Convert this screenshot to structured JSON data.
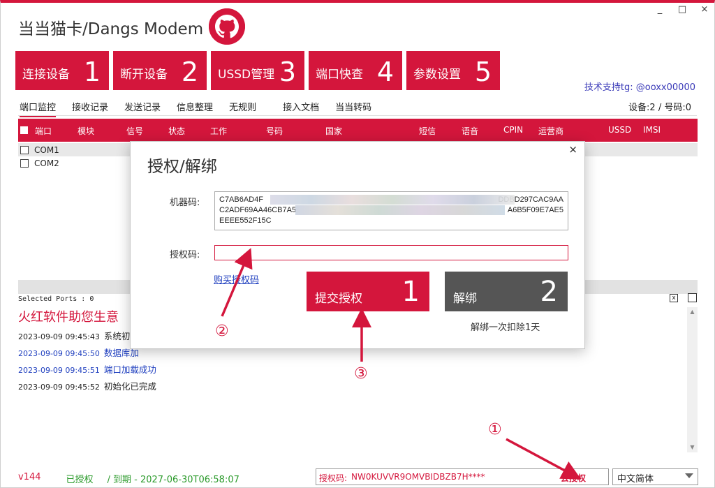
{
  "app": {
    "title": "当当猫卡/Dangs Modem",
    "window_controls": [
      "_",
      "□",
      "×"
    ]
  },
  "big_buttons": [
    {
      "label": "连接设备",
      "num": "1"
    },
    {
      "label": "断开设备",
      "num": "2"
    },
    {
      "label": "USSD管理",
      "num": "3"
    },
    {
      "label": "端口快查",
      "num": "4"
    },
    {
      "label": "参数设置",
      "num": "5"
    }
  ],
  "support_text": "技术支持tg: @ooxx00000",
  "tabs": [
    "端口监控",
    "接收记录",
    "发送记录",
    "信息整理",
    "无规则",
    "接入文档",
    "当当转码"
  ],
  "device_count": "设备:2 / 号码:0",
  "grid": {
    "columns": [
      "端口",
      "模块",
      "信号",
      "状态",
      "工作",
      "号码",
      "国家",
      "短信",
      "语音",
      "CPIN",
      "运营商",
      "USSD",
      "IMSI"
    ],
    "rows": [
      "COM1",
      "COM2"
    ]
  },
  "log": {
    "selected_ports": "Selected Ports : 0",
    "ad": "火红软件助您生意",
    "lines": [
      {
        "time": "2023-09-09 09:45:43",
        "msg": "系统初始",
        "color": "#222222"
      },
      {
        "time": "2023-09-09 09:45:50",
        "msg": "数据库加",
        "color": "#1f3fbf"
      },
      {
        "time": "2023-09-09 09:45:51",
        "msg": "端口加载成功",
        "color": "#1f3fbf"
      },
      {
        "time": "2023-09-09 09:45:52",
        "msg": "初始化已完成",
        "color": "#222222"
      }
    ]
  },
  "status": {
    "version": "v144",
    "authorized": "已授权",
    "expiry": "/   到期 - 2027-06-30T06:58:07",
    "authcode_label": "授权码:",
    "authcode_value": "NW0KUVVR9OMVBIDBZB7H****",
    "go_auth": "去授权",
    "language": "中文简体"
  },
  "dialog": {
    "title": "授权/解绑",
    "close": "×",
    "machine_code_label": "机器码:",
    "machine_code_line1": "C7AB6AD4F",
    "machine_code_line1_end": "DDBD297CAC9AA",
    "machine_code_line2": "C2ADF69AA46CB7A5",
    "machine_code_line2_end": "A6B5F09E7AE5",
    "machine_code_line3": "EEEE552F15C",
    "auth_code_label": "授权码:",
    "auth_code_value": "",
    "buy_link": "购买授权码",
    "submit_label": "提交授权",
    "submit_num": "1",
    "unbind_label": "解绑",
    "unbind_num": "2",
    "unbind_note": "解绑一次扣除1天"
  },
  "annotations": [
    "①",
    "②",
    "③"
  ],
  "colors": {
    "accent": "#d4163c",
    "unbind": "#555555",
    "green": "#2a9a2a",
    "link": "#1f3fbf"
  }
}
